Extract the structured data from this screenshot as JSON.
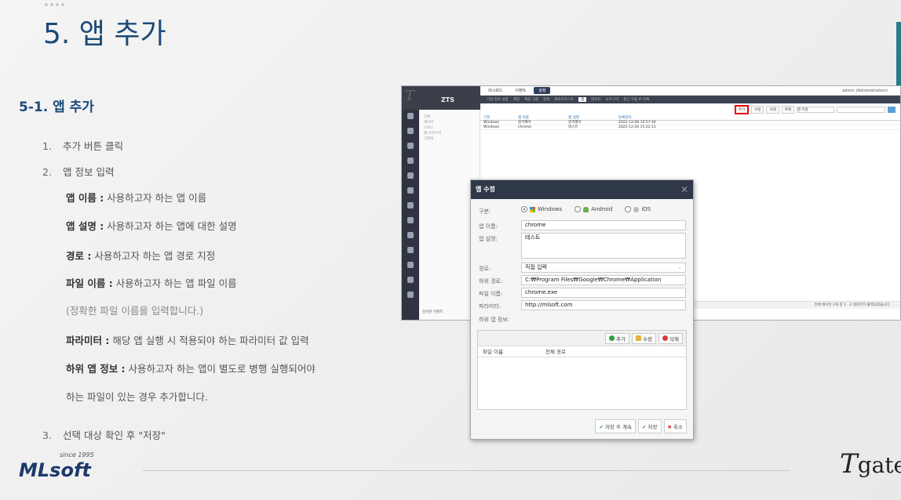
{
  "slide": {
    "title": "5.  앱 추가",
    "section": "5-1. 앱 추가",
    "steps": [
      {
        "num": "1.",
        "text": "추가 버튼 클릭"
      },
      {
        "num": "2.",
        "text": "앱 정보 입력"
      },
      {
        "num": "3.",
        "text": "선택 대상 확인 후 \"저장\""
      }
    ],
    "details": [
      {
        "label": "앱 이름 :",
        "text": " 사용하고자 하는 앱 이름"
      },
      {
        "label": "앱 설명 :",
        "text": " 사용하고자 하는 앱에 대한 설명"
      },
      {
        "label": "경로 :",
        "text": " 사용하고자 하는 앱 경로 지정"
      },
      {
        "label": "파일 이름 :",
        "text": " 사용하고자 하는 앱 파일 이름"
      },
      {
        "note": "(정확한 파일 이름을 입력합니다.)"
      },
      {
        "label": "파라미터 :",
        "text": " 해당 앱 실행 시 적용되야 하는 파라미터 값 입력"
      },
      {
        "label": "하위 앱 정보 :",
        "text": " 사용하고자 하는 앱이 별도로 병행 실행되어야"
      },
      {
        "text2": "하는 파일이 있는 경우 추가합니다."
      }
    ]
  },
  "footer": {
    "mlsoft_since": "since 1995",
    "mlsoft_word": "MLsoft",
    "tgate_t": "T",
    "tgate_rest": "gate"
  },
  "app": {
    "logo": "ZTS",
    "tabs": [
      {
        "label": "대시보드",
        "active": false
      },
      {
        "label": "이벤트",
        "active": false
      },
      {
        "label": "설정",
        "active": true
      }
    ],
    "admin": "admin (Administrators)",
    "menu": [
      "기업 정보 설정",
      "계정",
      "계정 그룹",
      "정책",
      "화이트리스트",
      "앱",
      "데이터",
      "보호구역",
      "접근 허용 IP 목록"
    ],
    "active_menu": "앱",
    "tree": [
      "전체",
      "에디터",
      "오피스",
      "웹 브라우저",
      "그래픽"
    ],
    "tree_bottom": "감사관 이벤트",
    "toolbar": [
      "추가",
      "수정",
      "삭제",
      "복제",
      "앱 이름"
    ],
    "grid_headers": [
      "구분",
      "앱 이름",
      "앱 설명",
      "등록일자"
    ],
    "grid_rows": [
      [
        "Windows",
        "원격제어",
        "원격제어",
        "2022-12-08 10:57:44"
      ],
      [
        "Windows",
        "chrome",
        "테스트",
        "2022-12-20 15:22:11"
      ]
    ],
    "status": "전체 데이터 2개 중 1 - 2 데이터가 출력되었습니다."
  },
  "modal": {
    "title": "앱 수정",
    "type_label": "구분:",
    "os": [
      {
        "label": "Windows",
        "checked": true,
        "icon": "windows-icon"
      },
      {
        "label": "Android",
        "checked": false,
        "icon": "android-icon"
      },
      {
        "label": "iOS",
        "checked": false,
        "icon": "apple-icon"
      }
    ],
    "name_label": "앱 이름:",
    "name_value": "chrome",
    "desc_label": "앱 설명:",
    "desc_value": "테스트",
    "path_label": "경로:",
    "path_value": "직접 입력",
    "subpath_label": "하위 경로:",
    "subpath_value": "C:₩Program Files₩Google₩Chrome₩Application",
    "file_label": "파일 이름:",
    "file_value": "chrome.exe",
    "param_label": "파라미터:",
    "param_value": "http://mlsoft.com",
    "subapp_label": "하위 앱 정보:",
    "sub_add": "추가",
    "sub_edit": "수정",
    "sub_delete": "삭제",
    "sub_col1": "파일 이름",
    "sub_col2": "전체 경로",
    "save_continue": "저장 후 계속",
    "save": "저장",
    "cancel": "취소"
  }
}
